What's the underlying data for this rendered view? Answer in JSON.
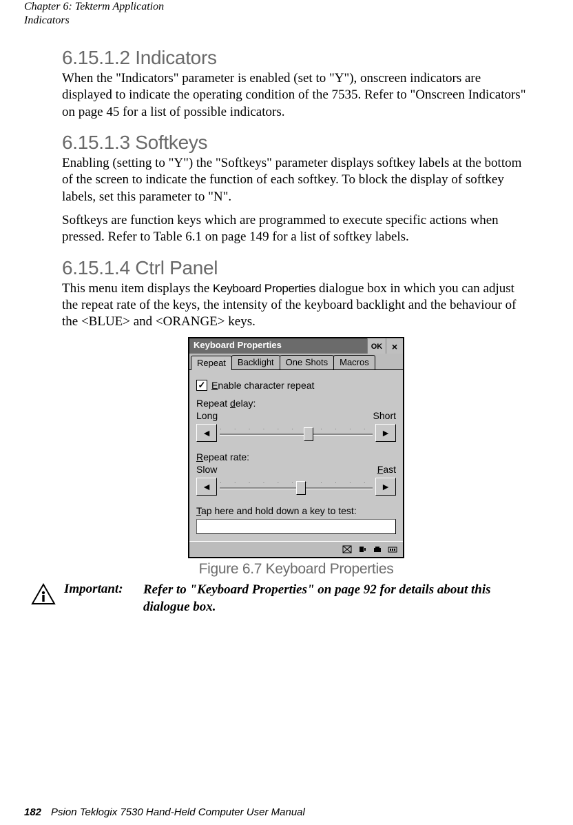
{
  "header": {
    "line1": "Chapter 6: Tekterm Application",
    "line2": "Indicators"
  },
  "sections": {
    "s1": {
      "title": "6.15.1.2  Indicators",
      "body": "When the \"Indicators\" parameter is enabled (set to \"Y\"), onscreen indicators are displayed to indicate the operating condition of the 7535. Refer to \"Onscreen Indicators\" on page 45 for a list of possible indicators."
    },
    "s2": {
      "title": "6.15.1.3  Softkeys",
      "p1": "Enabling (setting to \"Y\") the \"Softkeys\" parameter displays softkey labels at the bottom of the screen to indicate the function of each softkey. To block the display of softkey labels, set this parameter to \"N\".",
      "p2": "Softkeys are function keys which are programmed to execute specific actions when pressed. Refer to Table 6.1 on page 149 for a list of softkey labels."
    },
    "s3": {
      "title": "6.15.1.4  Ctrl Panel",
      "p1a": "This menu item displays the ",
      "p1b": "Keyboard Properties",
      "p1c": " dialogue box in which you can adjust the repeat rate of the keys, the intensity of the keyboard backlight and the behaviour of the <BLUE> and <ORANGE> keys."
    }
  },
  "dialog": {
    "title": "Keyboard Properties",
    "ok": "OK",
    "close": "×",
    "tabs": [
      "Repeat",
      "Backlight",
      "One Shots",
      "Macros"
    ],
    "enable_repeat_pre": "E",
    "enable_repeat_rest": "nable character repeat",
    "checkbox_mark": "✓",
    "repeat_delay_pre": "Repeat ",
    "repeat_delay_u": "d",
    "repeat_delay_post": "elay:",
    "long": "Long",
    "short": "Short",
    "repeat_rate_u": "R",
    "repeat_rate_post": "epeat rate:",
    "slow": "Slow",
    "fast_u": "F",
    "fast_post": "ast",
    "tap_pre": "T",
    "tap_post": "ap here and hold down a key to test:",
    "arrow_left": "◄",
    "arrow_right": "►"
  },
  "figure": {
    "caption": "Figure 6.7 Keyboard Properties"
  },
  "important": {
    "label": "Important:",
    "text": "Refer to \"Keyboard Properties\" on page 92 for details about this dialogue box."
  },
  "footer": {
    "page": "182",
    "text": "Psion Teklogix 7530 Hand-Held Computer User Manual"
  }
}
